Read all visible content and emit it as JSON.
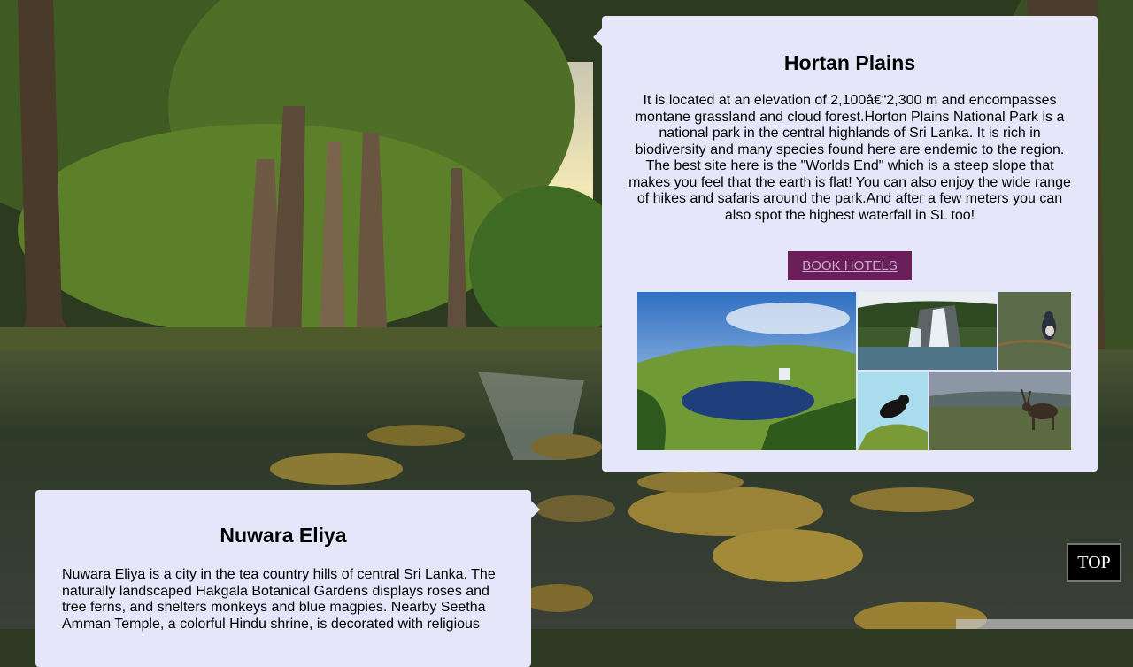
{
  "hortan": {
    "title": "Hortan Plains",
    "description": "It is located at an elevation of 2,100â€“2,300 m and encompasses montane grassland and cloud forest.Horton Plains National Park is a national park in the central highlands of Sri Lanka. It is rich in biodiversity and many species found here are endemic to the region. The best site here is the \"Worlds End\" which is a steep slope that makes you feel that the earth is flat! You can also enjoy the wide range of hikes and safaris around the park.And after a few meters you can also spot the highest waterfall in SL too!",
    "book_button": "BOOK HOTELS"
  },
  "nuwara": {
    "title": "Nuwara Eliya",
    "description": "Nuwara Eliya is a city in the tea country hills of central Sri Lanka. The naturally landscaped Hakgala Botanical Gardens displays roses and tree ferns, and shelters monkeys and blue magpies. Nearby Seetha Amman Temple, a colorful Hindu shrine, is decorated with religious"
  },
  "top_button": "TOP",
  "colors": {
    "card_bg": "#e6e6fa",
    "button_bg": "#6b1f5a",
    "button_text": "#c9a9c9"
  }
}
